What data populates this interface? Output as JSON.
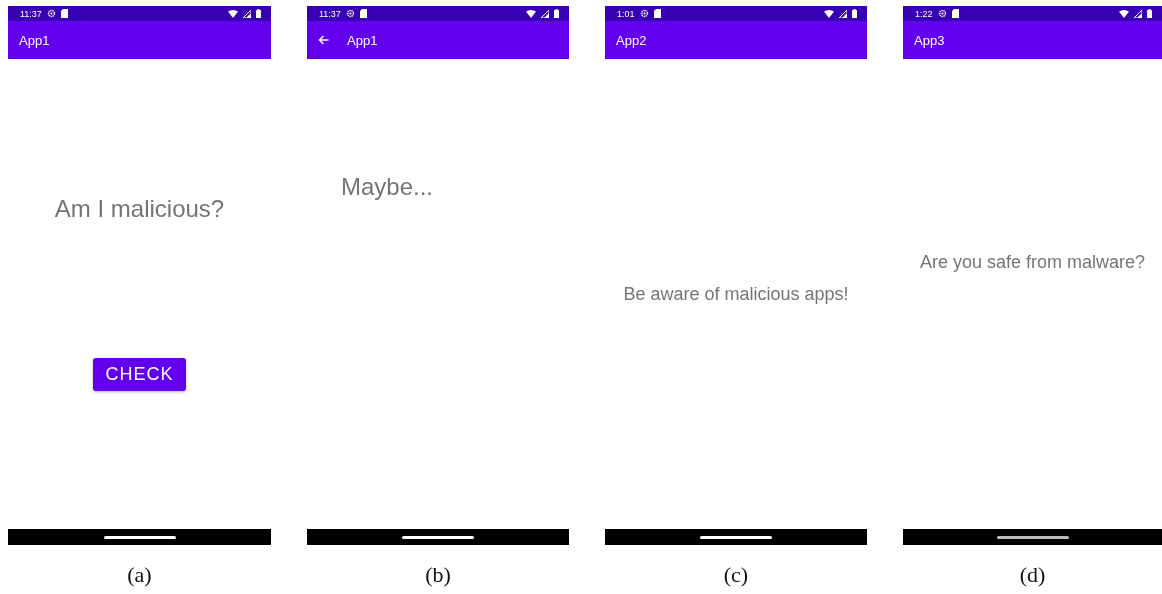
{
  "screens": [
    {
      "status_bar": {
        "time": "11:37"
      },
      "app_bar": {
        "title": "App1",
        "back": false
      },
      "content": {
        "kind": "prompt",
        "text": "Am I malicious?",
        "button": "CHECK"
      },
      "caption": "(a)"
    },
    {
      "status_bar": {
        "time": "11:37"
      },
      "app_bar": {
        "title": "App1",
        "back": true
      },
      "content": {
        "kind": "result",
        "text": "Maybe..."
      },
      "caption": "(b)"
    },
    {
      "status_bar": {
        "time": "1:01"
      },
      "app_bar": {
        "title": "App2",
        "back": false
      },
      "content": {
        "kind": "message",
        "text": "Be aware of malicious apps!"
      },
      "caption": "(c)"
    },
    {
      "status_bar": {
        "time": "1:22"
      },
      "app_bar": {
        "title": "App3",
        "back": false
      },
      "content": {
        "kind": "notice",
        "text": "Are you safe from malware?"
      },
      "caption": "(d)"
    }
  ]
}
